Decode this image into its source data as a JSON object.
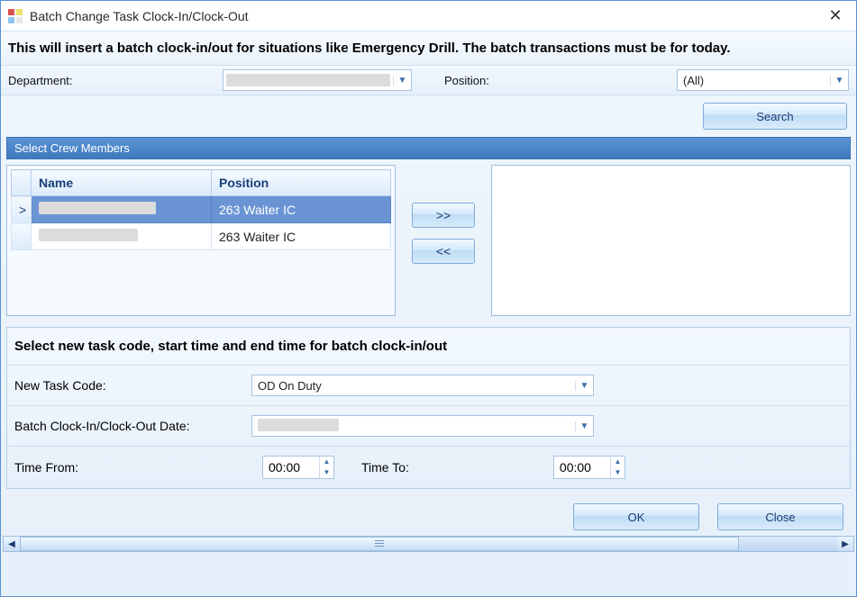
{
  "window": {
    "title": "Batch Change Task Clock-In/Clock-Out",
    "close_glyph": "✕"
  },
  "banner": "This will insert a batch clock-in/out for situations like Emergency Drill. The batch transactions must be for today.",
  "filters": {
    "department_label": "Department:",
    "department_value": "",
    "position_label": "Position:",
    "position_value": "(All)",
    "search_label": "Search"
  },
  "crew": {
    "header": "Select Crew Members",
    "columns": {
      "name": "Name",
      "position": "Position"
    },
    "rows": [
      {
        "name": "",
        "position": "263 Waiter IC",
        "selected": true,
        "indicator": ">"
      },
      {
        "name": "",
        "position": "263 Waiter IC",
        "selected": false,
        "indicator": ""
      }
    ],
    "add_label": ">>",
    "remove_label": "<<"
  },
  "task_section": {
    "title": "Select new task code, start time and end time for batch clock-in/out",
    "new_task_code_label": "New Task Code:",
    "new_task_code_value": "OD On Duty",
    "date_label": "Batch Clock-In/Clock-Out Date:",
    "date_value": "",
    "time_from_label": "Time From:",
    "time_from_value": "00:00",
    "time_to_label": "Time To:",
    "time_to_value": "00:00"
  },
  "buttons": {
    "ok": "OK",
    "close": "Close"
  }
}
